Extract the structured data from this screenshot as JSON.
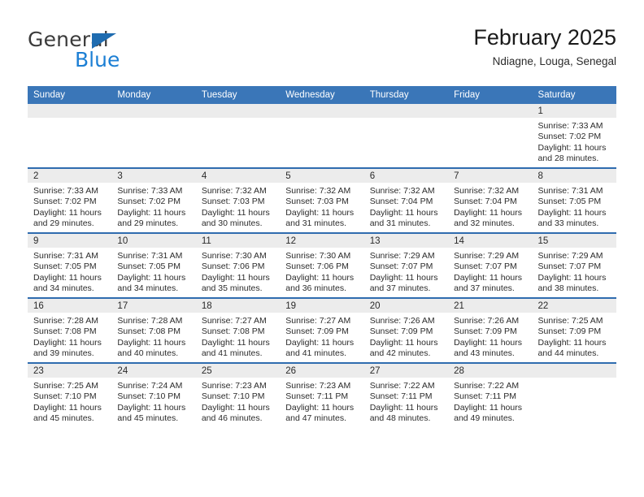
{
  "logo": {
    "word1": "General",
    "word2": "Blue",
    "triangle_color": "#1f6cb0",
    "word1_color": "#3b3b3b",
    "word2_color": "#1c7fd4"
  },
  "header": {
    "title": "February 2025",
    "subtitle": "Ndiagne, Louga, Senegal"
  },
  "theme": {
    "header_row_bg": "#3a76b8",
    "header_row_text": "#ffffff",
    "day_band_bg": "#ececec",
    "row_divider": "#2f6caf"
  },
  "weekday_headers": [
    "Sunday",
    "Monday",
    "Tuesday",
    "Wednesday",
    "Thursday",
    "Friday",
    "Saturday"
  ],
  "weeks": [
    [
      {
        "day": "",
        "sunrise": "",
        "sunset": "",
        "daylight": "",
        "empty": true
      },
      {
        "day": "",
        "sunrise": "",
        "sunset": "",
        "daylight": "",
        "empty": true
      },
      {
        "day": "",
        "sunrise": "",
        "sunset": "",
        "daylight": "",
        "empty": true
      },
      {
        "day": "",
        "sunrise": "",
        "sunset": "",
        "daylight": "",
        "empty": true
      },
      {
        "day": "",
        "sunrise": "",
        "sunset": "",
        "daylight": "",
        "empty": true
      },
      {
        "day": "",
        "sunrise": "",
        "sunset": "",
        "daylight": "",
        "empty": true
      },
      {
        "day": "1",
        "sunrise": "Sunrise: 7:33 AM",
        "sunset": "Sunset: 7:02 PM",
        "daylight": "Daylight: 11 hours and 28 minutes.",
        "empty": false
      }
    ],
    [
      {
        "day": "2",
        "sunrise": "Sunrise: 7:33 AM",
        "sunset": "Sunset: 7:02 PM",
        "daylight": "Daylight: 11 hours and 29 minutes.",
        "empty": false
      },
      {
        "day": "3",
        "sunrise": "Sunrise: 7:33 AM",
        "sunset": "Sunset: 7:02 PM",
        "daylight": "Daylight: 11 hours and 29 minutes.",
        "empty": false
      },
      {
        "day": "4",
        "sunrise": "Sunrise: 7:32 AM",
        "sunset": "Sunset: 7:03 PM",
        "daylight": "Daylight: 11 hours and 30 minutes.",
        "empty": false
      },
      {
        "day": "5",
        "sunrise": "Sunrise: 7:32 AM",
        "sunset": "Sunset: 7:03 PM",
        "daylight": "Daylight: 11 hours and 31 minutes.",
        "empty": false
      },
      {
        "day": "6",
        "sunrise": "Sunrise: 7:32 AM",
        "sunset": "Sunset: 7:04 PM",
        "daylight": "Daylight: 11 hours and 31 minutes.",
        "empty": false
      },
      {
        "day": "7",
        "sunrise": "Sunrise: 7:32 AM",
        "sunset": "Sunset: 7:04 PM",
        "daylight": "Daylight: 11 hours and 32 minutes.",
        "empty": false
      },
      {
        "day": "8",
        "sunrise": "Sunrise: 7:31 AM",
        "sunset": "Sunset: 7:05 PM",
        "daylight": "Daylight: 11 hours and 33 minutes.",
        "empty": false
      }
    ],
    [
      {
        "day": "9",
        "sunrise": "Sunrise: 7:31 AM",
        "sunset": "Sunset: 7:05 PM",
        "daylight": "Daylight: 11 hours and 34 minutes.",
        "empty": false
      },
      {
        "day": "10",
        "sunrise": "Sunrise: 7:31 AM",
        "sunset": "Sunset: 7:05 PM",
        "daylight": "Daylight: 11 hours and 34 minutes.",
        "empty": false
      },
      {
        "day": "11",
        "sunrise": "Sunrise: 7:30 AM",
        "sunset": "Sunset: 7:06 PM",
        "daylight": "Daylight: 11 hours and 35 minutes.",
        "empty": false
      },
      {
        "day": "12",
        "sunrise": "Sunrise: 7:30 AM",
        "sunset": "Sunset: 7:06 PM",
        "daylight": "Daylight: 11 hours and 36 minutes.",
        "empty": false
      },
      {
        "day": "13",
        "sunrise": "Sunrise: 7:29 AM",
        "sunset": "Sunset: 7:07 PM",
        "daylight": "Daylight: 11 hours and 37 minutes.",
        "empty": false
      },
      {
        "day": "14",
        "sunrise": "Sunrise: 7:29 AM",
        "sunset": "Sunset: 7:07 PM",
        "daylight": "Daylight: 11 hours and 37 minutes.",
        "empty": false
      },
      {
        "day": "15",
        "sunrise": "Sunrise: 7:29 AM",
        "sunset": "Sunset: 7:07 PM",
        "daylight": "Daylight: 11 hours and 38 minutes.",
        "empty": false
      }
    ],
    [
      {
        "day": "16",
        "sunrise": "Sunrise: 7:28 AM",
        "sunset": "Sunset: 7:08 PM",
        "daylight": "Daylight: 11 hours and 39 minutes.",
        "empty": false
      },
      {
        "day": "17",
        "sunrise": "Sunrise: 7:28 AM",
        "sunset": "Sunset: 7:08 PM",
        "daylight": "Daylight: 11 hours and 40 minutes.",
        "empty": false
      },
      {
        "day": "18",
        "sunrise": "Sunrise: 7:27 AM",
        "sunset": "Sunset: 7:08 PM",
        "daylight": "Daylight: 11 hours and 41 minutes.",
        "empty": false
      },
      {
        "day": "19",
        "sunrise": "Sunrise: 7:27 AM",
        "sunset": "Sunset: 7:09 PM",
        "daylight": "Daylight: 11 hours and 41 minutes.",
        "empty": false
      },
      {
        "day": "20",
        "sunrise": "Sunrise: 7:26 AM",
        "sunset": "Sunset: 7:09 PM",
        "daylight": "Daylight: 11 hours and 42 minutes.",
        "empty": false
      },
      {
        "day": "21",
        "sunrise": "Sunrise: 7:26 AM",
        "sunset": "Sunset: 7:09 PM",
        "daylight": "Daylight: 11 hours and 43 minutes.",
        "empty": false
      },
      {
        "day": "22",
        "sunrise": "Sunrise: 7:25 AM",
        "sunset": "Sunset: 7:09 PM",
        "daylight": "Daylight: 11 hours and 44 minutes.",
        "empty": false
      }
    ],
    [
      {
        "day": "23",
        "sunrise": "Sunrise: 7:25 AM",
        "sunset": "Sunset: 7:10 PM",
        "daylight": "Daylight: 11 hours and 45 minutes.",
        "empty": false
      },
      {
        "day": "24",
        "sunrise": "Sunrise: 7:24 AM",
        "sunset": "Sunset: 7:10 PM",
        "daylight": "Daylight: 11 hours and 45 minutes.",
        "empty": false
      },
      {
        "day": "25",
        "sunrise": "Sunrise: 7:23 AM",
        "sunset": "Sunset: 7:10 PM",
        "daylight": "Daylight: 11 hours and 46 minutes.",
        "empty": false
      },
      {
        "day": "26",
        "sunrise": "Sunrise: 7:23 AM",
        "sunset": "Sunset: 7:11 PM",
        "daylight": "Daylight: 11 hours and 47 minutes.",
        "empty": false
      },
      {
        "day": "27",
        "sunrise": "Sunrise: 7:22 AM",
        "sunset": "Sunset: 7:11 PM",
        "daylight": "Daylight: 11 hours and 48 minutes.",
        "empty": false
      },
      {
        "day": "28",
        "sunrise": "Sunrise: 7:22 AM",
        "sunset": "Sunset: 7:11 PM",
        "daylight": "Daylight: 11 hours and 49 minutes.",
        "empty": false
      },
      {
        "day": "",
        "sunrise": "",
        "sunset": "",
        "daylight": "",
        "empty": true
      }
    ]
  ]
}
